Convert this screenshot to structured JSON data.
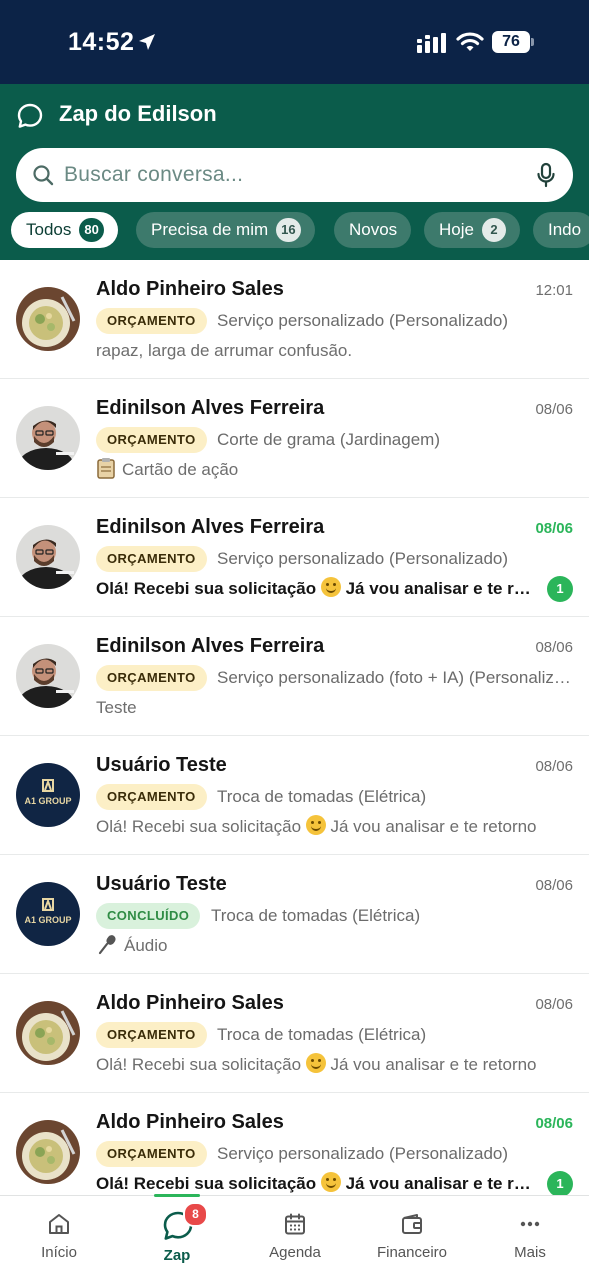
{
  "status_bar": {
    "time": "14:52",
    "battery": "76"
  },
  "header": {
    "title": "Zap do Edilson",
    "search_placeholder": "Buscar conversa..."
  },
  "filters": [
    {
      "label": "Todos",
      "count": "80",
      "active": true
    },
    {
      "label": "Precisa de mim",
      "count": "16",
      "active": false
    },
    {
      "label": "Novos",
      "count": "",
      "active": false
    },
    {
      "label": "Hoje",
      "count": "2",
      "active": false
    },
    {
      "label": "Indo",
      "count": "",
      "active": false
    }
  ],
  "conversations": [
    {
      "name": "Aldo Pinheiro Sales",
      "time": "12:01",
      "time_unread": false,
      "badge": "ORÇAMENTO",
      "badge_type": "orc",
      "service": "Serviço personalizado (Personalizado)",
      "preview_icon": "",
      "preview": "rapaz, larga de arrumar confusão.",
      "preview_unread": false,
      "unread_count": "",
      "avatar": "food"
    },
    {
      "name": "Edinilson Alves Ferreira",
      "time": "08/06",
      "time_unread": false,
      "badge": "ORÇAMENTO",
      "badge_type": "orc",
      "service": "Corte de grama (Jardinagem)",
      "preview_icon": "clipboard-icon",
      "preview": "Cartão de ação",
      "preview_unread": false,
      "unread_count": "",
      "avatar": "man"
    },
    {
      "name": "Edinilson Alves Ferreira",
      "time": "08/06",
      "time_unread": true,
      "badge": "ORÇAMENTO",
      "badge_type": "orc",
      "service": "Serviço personalizado (Personalizado)",
      "preview_icon": "",
      "preview": "Olá! Recebi sua solicitação 😊 Já vou analisar e te retorno",
      "preview_unread": true,
      "unread_count": "1",
      "avatar": "man"
    },
    {
      "name": "Edinilson Alves Ferreira",
      "time": "08/06",
      "time_unread": false,
      "badge": "ORÇAMENTO",
      "badge_type": "orc",
      "service": "Serviço personalizado (foto + IA) (Personalizado)",
      "preview_icon": "",
      "preview": "Teste",
      "preview_unread": false,
      "unread_count": "",
      "avatar": "man"
    },
    {
      "name": "Usuário Teste",
      "time": "08/06",
      "time_unread": false,
      "badge": "ORÇAMENTO",
      "badge_type": "orc",
      "service": "Troca de tomadas (Elétrica)",
      "preview_icon": "",
      "preview": "Olá! Recebi sua solicitação 😊 Já vou analisar e te retorno",
      "preview_unread": false,
      "unread_count": "",
      "avatar": "logo"
    },
    {
      "name": "Usuário Teste",
      "time": "08/06",
      "time_unread": false,
      "badge": "CONCLUÍDO",
      "badge_type": "done",
      "service": "Troca de tomadas (Elétrica)",
      "preview_icon": "microphone-icon",
      "preview": "Áudio",
      "preview_unread": false,
      "unread_count": "",
      "avatar": "logo"
    },
    {
      "name": "Aldo Pinheiro Sales",
      "time": "08/06",
      "time_unread": false,
      "badge": "ORÇAMENTO",
      "badge_type": "orc",
      "service": "Troca de tomadas (Elétrica)",
      "preview_icon": "",
      "preview": "Olá! Recebi sua solicitação 😊 Já vou analisar e te retorno",
      "preview_unread": false,
      "unread_count": "",
      "avatar": "food"
    },
    {
      "name": "Aldo Pinheiro Sales",
      "time": "08/06",
      "time_unread": true,
      "badge": "ORÇAMENTO",
      "badge_type": "orc",
      "service": "Serviço personalizado (Personalizado)",
      "preview_icon": "",
      "preview": "Olá! Recebi sua solicitação 😊 Já vou analisar e te retorno",
      "preview_unread": true,
      "unread_count": "1",
      "avatar": "food"
    }
  ],
  "avatar_logo_text": "A1 GROUP",
  "bottom_nav": [
    {
      "label": "Início",
      "icon": "home-icon",
      "active": false,
      "badge": ""
    },
    {
      "label": "Zap",
      "icon": "chat-icon",
      "active": true,
      "badge": "8"
    },
    {
      "label": "Agenda",
      "icon": "calendar-icon",
      "active": false,
      "badge": ""
    },
    {
      "label": "Financeiro",
      "icon": "wallet-icon",
      "active": false,
      "badge": ""
    },
    {
      "label": "Mais",
      "icon": "more-icon",
      "active": false,
      "badge": ""
    }
  ],
  "colors": {
    "status_bar": "#0c2347",
    "header": "#0b5c4b",
    "accent_green": "#2bb55a",
    "badge_orcamento": "#fcefc6",
    "badge_concluido": "#d9f1dc",
    "nav_badge": "#e84949"
  }
}
